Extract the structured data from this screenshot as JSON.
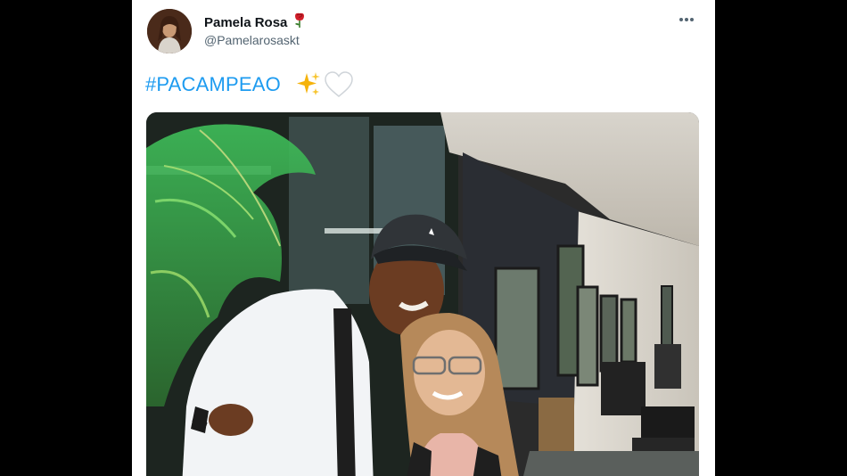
{
  "tweet": {
    "author_name": "Pamela Rosa",
    "author_handle": "@Pamelarosaskt",
    "hashtag": "#PACAMPEAO",
    "name_emoji_icon": "rose-icon",
    "text_emoji_icons": [
      "sparkles-icon",
      "white-heart-icon"
    ],
    "more_icon": "more-options-icon",
    "media": {
      "type": "photo",
      "icon": "photo"
    }
  },
  "colors": {
    "background": "#000000",
    "card": "#ffffff",
    "hashtag": "#1d9bf0",
    "name": "#0f1419",
    "secondary": "#536471"
  }
}
